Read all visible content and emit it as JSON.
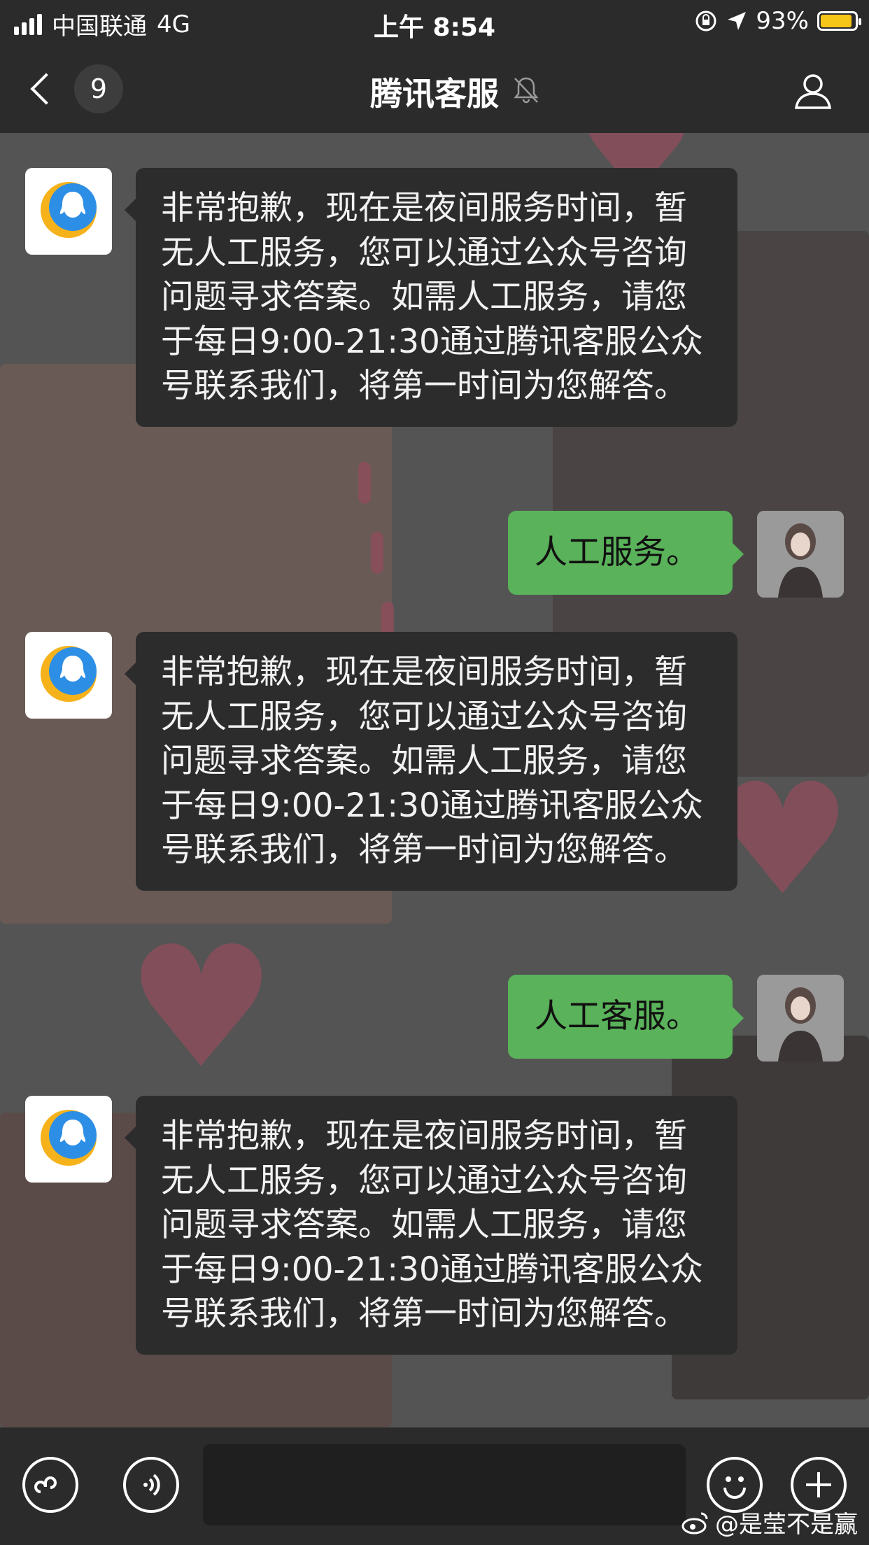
{
  "status_bar": {
    "carrier": "中国联通",
    "network": "4G",
    "time": "上午 8:54",
    "battery_text": "93%",
    "battery_level": 0.93
  },
  "nav": {
    "unread_count": "9",
    "title": "腾讯客服"
  },
  "messages": [
    {
      "from": "service",
      "text": "非常抱歉，现在是夜间服务时间，暂无人工服务，您可以通过公众号咨询问题寻求答案。如需人工服务，请您于每日9:00-21:30通过腾讯客服公众号联系我们，将第一时间为您解答。"
    },
    {
      "from": "user",
      "text": "人工服务。"
    },
    {
      "from": "service",
      "text": "非常抱歉，现在是夜间服务时间，暂无人工服务，您可以通过公众号咨询问题寻求答案。如需人工服务，请您于每日9:00-21:30通过腾讯客服公众号联系我们，将第一时间为您解答。"
    },
    {
      "from": "user",
      "text": "人工客服。"
    },
    {
      "from": "service",
      "text": "非常抱歉，现在是夜间服务时间，暂无人工服务，您可以通过公众号咨询问题寻求答案。如需人工服务，请您于每日9:00-21:30通过腾讯客服公众号联系我们，将第一时间为您解答。"
    }
  ],
  "input_bar": {
    "text_value": ""
  },
  "watermark": "@是莹不是赢",
  "colors": {
    "outgoing_bubble": "#5ab25a",
    "incoming_bubble": "#2c2c2c",
    "bar_background": "#2b2b2b",
    "battery": "#f5c518",
    "qq_logo_blue": "#2d8ee6",
    "qq_logo_yellow": "#f5b21b"
  },
  "icons": [
    "back-chevron-icon",
    "bell-muted-icon",
    "contact-person-icon",
    "mini-program-icon",
    "voice-icon",
    "emoji-icon",
    "plus-icon",
    "weibo-icon"
  ]
}
